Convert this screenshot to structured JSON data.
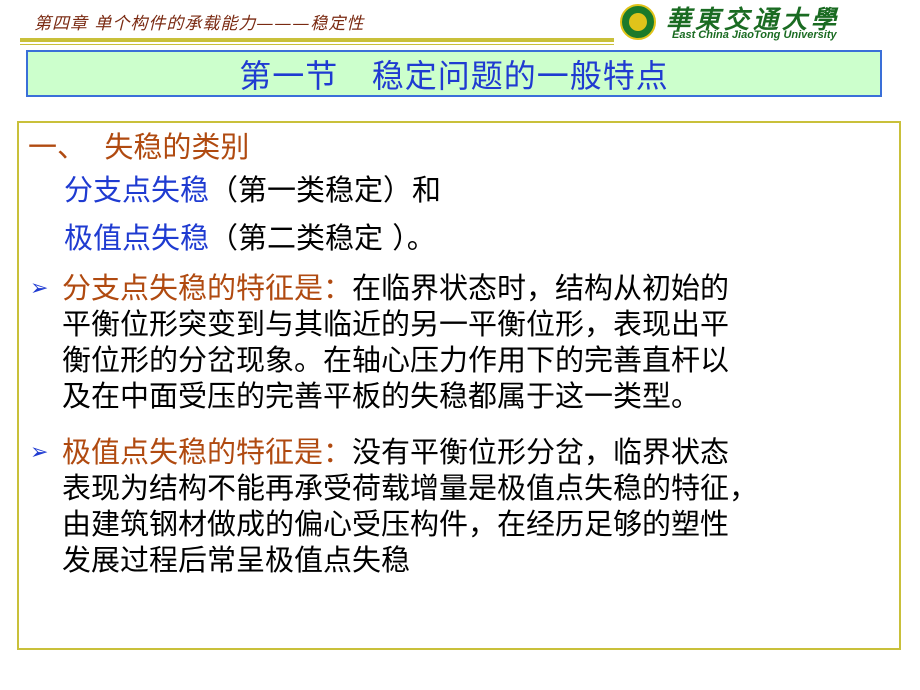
{
  "header": {
    "chapter": "第四章 单个构件的承载能力———稳定性",
    "logo_cn": "華東交通大學",
    "logo_en": "East China JiaoTong University"
  },
  "title": "第一节   稳定问题的一般特点",
  "section": {
    "heading": "一、  失稳的类别",
    "type1_term": "分支点失稳",
    "type1_rest": "（第一类稳定）和",
    "type2_term": "极值点失稳",
    "type2_rest": "（第二类稳定 ）。"
  },
  "bullets": [
    {
      "label": "分支点失稳的特征是：",
      "lines": [
        "在临界状态时，结构从初始的",
        "平衡位形突变到与其临近的另一平衡位形，表现出平",
        "衡位形的分岔现象。在轴心压力作用下的完善直杆以",
        "及在中面受压的完善平板的失稳都属于这一类型。"
      ]
    },
    {
      "label": "极值点失稳的特征是：",
      "lines": [
        "没有平衡位形分岔，临界状态",
        "表现为结构不能再承受荷载增量是极值点失稳的特征，",
        "由建筑钢材做成的偏心受压构件，在经历足够的塑性",
        "发展过程后常呈极值点失稳"
      ]
    }
  ],
  "icons": {
    "bullet": "chevron-right-icon",
    "bullet_glyph": "➢"
  },
  "colors": {
    "title_bg": "#ccffcc",
    "title_border": "#3a6fd8",
    "title_text": "#1f3bd1",
    "frame": "#c9c03a",
    "term_blue": "#1f3bd1",
    "label_brown": "#b04a10",
    "header_text": "#7a2a12",
    "logo_green": "#1a6b22"
  }
}
